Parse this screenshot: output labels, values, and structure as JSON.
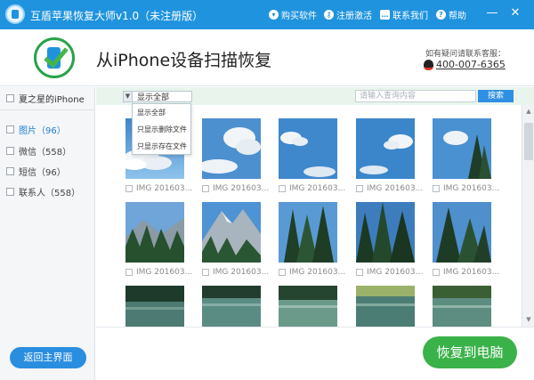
{
  "window": {
    "title": "互盾苹果恢复大师v1.0（未注册版）",
    "buttons": [
      {
        "label": "购买软件",
        "icon": "cart-icon"
      },
      {
        "label": "注册激活",
        "icon": "key-icon"
      },
      {
        "label": "联系我们",
        "icon": "chat-icon"
      },
      {
        "label": "帮助",
        "icon": "help-icon"
      }
    ],
    "controls": {
      "minimize": "—",
      "close": "✕"
    }
  },
  "header": {
    "title": "从iPhone设备扫描恢复",
    "support_label": "如有疑问请联系客服：",
    "support_phone": "400-007-6365"
  },
  "sidebar": {
    "device": "夏之星的iPhone",
    "categories": [
      {
        "label": "图片（96）",
        "active": true
      },
      {
        "label": "微信（558）",
        "active": false
      },
      {
        "label": "短信（96）",
        "active": false
      },
      {
        "label": "联系人（558）",
        "active": false
      }
    ],
    "back_button": "返回主界面"
  },
  "toolbar": {
    "filter_value": "显示全部",
    "search_placeholder": "请输入查询内容",
    "search_button": "搜索"
  },
  "dropdown": {
    "options": [
      "显示全部",
      "只显示删除文件",
      "只显示存在文件"
    ]
  },
  "grid": {
    "labels": [
      "IMG 201603...",
      "IMG 201603...",
      "IMG 201603...",
      "IMG 201603...",
      "IMG 201603...",
      "IMG 201603...",
      "IMG 201603...",
      "IMG 201603...",
      "IMG 201603...",
      "IMG 201603..."
    ],
    "thumbs": [
      "sky-clouds",
      "sky-clouds",
      "sky-clouds",
      "sky-clouds",
      "sky-tree",
      "forest-mountain",
      "mountain-peak",
      "pine-forest",
      "pine-forest",
      "pine-forest",
      "lake-trees",
      "lake-trees",
      "lake-trees",
      "lake-trees",
      "lake-trees"
    ]
  },
  "scrollbar": {
    "up": "▲",
    "down": "▼"
  },
  "footer": {
    "recover_button": "恢复到电脑"
  },
  "colors": {
    "titlebar": "#1f93de",
    "accent_blue": "#2a8ee0",
    "recover_green": "#3ab24a",
    "toolbar_bg": "#e9f5ec"
  }
}
